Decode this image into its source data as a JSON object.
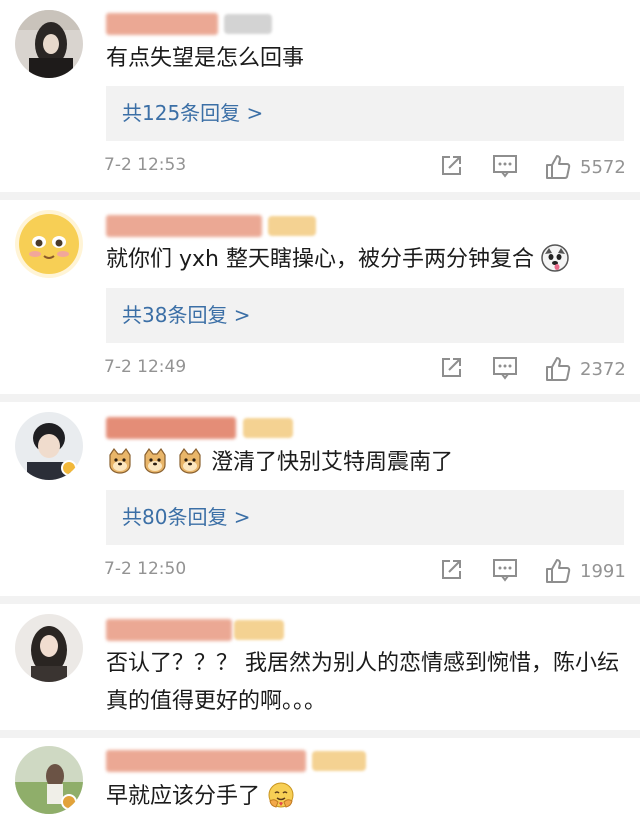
{
  "colors": {
    "link": "#3b6fa6",
    "meta": "#939393",
    "reply_bg": "#f2f2f2"
  },
  "comments": [
    {
      "text": "有点失望是怎么回事",
      "replies": "共125条回复 >",
      "time": "7-2 12:53",
      "likes": "5572"
    },
    {
      "text": "就你们 yxh 整天瞎操心，被分手两分钟复合",
      "replies": "共38条回复 >",
      "time": "7-2 12:49",
      "likes": "2372"
    },
    {
      "text": "澄清了快别艾特周震南了",
      "replies": "共80条回复 >",
      "time": "7-2 12:50",
      "likes": "1991"
    },
    {
      "text": "否认了？？？ 我居然为别人的恋情感到惋惜，陈小纭真的值得更好的啊。。。"
    },
    {
      "text": "早就应该分手了"
    }
  ],
  "icons": {
    "share": "share-icon",
    "comment": "comment-icon",
    "like": "thumbs-up-icon",
    "emoji_dog": "doge-emoji-icon",
    "emoji_husky": "husky-emoji-icon",
    "emoji_hug": "hug-emoji-icon"
  }
}
